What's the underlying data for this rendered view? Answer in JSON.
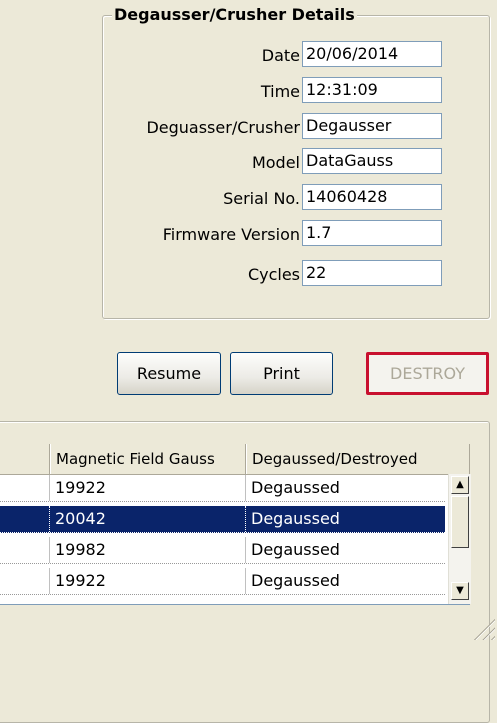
{
  "details": {
    "title": "Degausser/Crusher Details",
    "fields": [
      {
        "label": "Date",
        "value": "20/06/2014"
      },
      {
        "label": "Time",
        "value": "12:31:09"
      },
      {
        "label": "Deguasser/Crusher",
        "value": "Degausser"
      },
      {
        "label": "Model",
        "value": "DataGauss"
      },
      {
        "label": "Serial No.",
        "value": "14060428"
      },
      {
        "label": "Firmware Version",
        "value": "1.7"
      },
      {
        "label": "Cycles",
        "value": "22"
      }
    ]
  },
  "buttons": {
    "resume": "Resume",
    "print": "Print",
    "destroy": "DESTROY"
  },
  "grid": {
    "columns": [
      "Magnetic Field Gauss",
      "Degaussed/Destroyed"
    ],
    "rows": [
      {
        "gauss": "19922",
        "status": "Degaussed",
        "selected": false
      },
      {
        "gauss": "20042",
        "status": "Degaussed",
        "selected": true
      },
      {
        "gauss": "19982",
        "status": "Degaussed",
        "selected": false
      },
      {
        "gauss": "19922",
        "status": "Degaussed",
        "selected": false
      }
    ]
  },
  "colors": {
    "selection": "#0a246a",
    "destroy_border": "#c8102e",
    "window": "#ece9d8"
  }
}
